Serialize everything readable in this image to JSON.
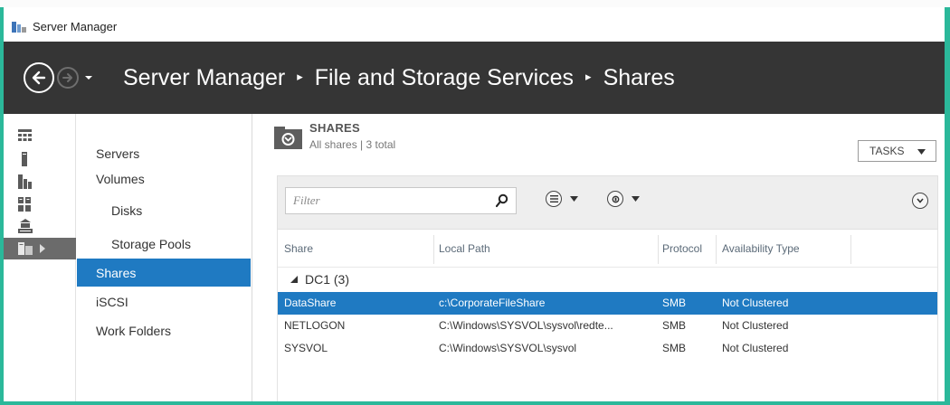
{
  "window": {
    "title": "Server Manager"
  },
  "header": {
    "breadcrumb": [
      "Server Manager",
      "File and Storage Services",
      "Shares"
    ],
    "separator": "▸"
  },
  "icon_rail": {
    "items": [
      {
        "name": "dashboard-icon"
      },
      {
        "name": "local-server-icon"
      },
      {
        "name": "all-servers-icon"
      },
      {
        "name": "ad-ds-icon"
      },
      {
        "name": "dns-icon"
      },
      {
        "name": "file-storage-services-icon",
        "active": true
      }
    ]
  },
  "sidebar": {
    "items": [
      {
        "label": "Servers"
      },
      {
        "label": "Volumes"
      },
      {
        "label": "Disks"
      },
      {
        "label": "Storage Pools"
      },
      {
        "label": "Shares",
        "selected": true
      },
      {
        "label": "iSCSI"
      },
      {
        "label": "Work Folders"
      }
    ]
  },
  "shares_panel": {
    "title": "SHARES",
    "subtitle": "All shares | 3 total",
    "tasks_label": "TASKS",
    "filter_placeholder": "Filter"
  },
  "table": {
    "columns": [
      "Share",
      "Local Path",
      "Protocol",
      "Availability Type"
    ],
    "group_label": "DC1 (3)",
    "rows": [
      {
        "share": "DataShare",
        "path": "c:\\CorporateFileShare",
        "protocol": "SMB",
        "availability": "Not Clustered",
        "selected": true
      },
      {
        "share": "NETLOGON",
        "path": "C:\\Windows\\SYSVOL\\sysvol\\redte...",
        "protocol": "SMB",
        "availability": "Not Clustered"
      },
      {
        "share": "SYSVOL",
        "path": "C:\\Windows\\SYSVOL\\sysvol",
        "protocol": "SMB",
        "availability": "Not Clustered"
      }
    ]
  },
  "colors": {
    "accent_selection": "#1f7ac2",
    "header_bg": "#353535",
    "frame_border": "#2bb89a"
  }
}
